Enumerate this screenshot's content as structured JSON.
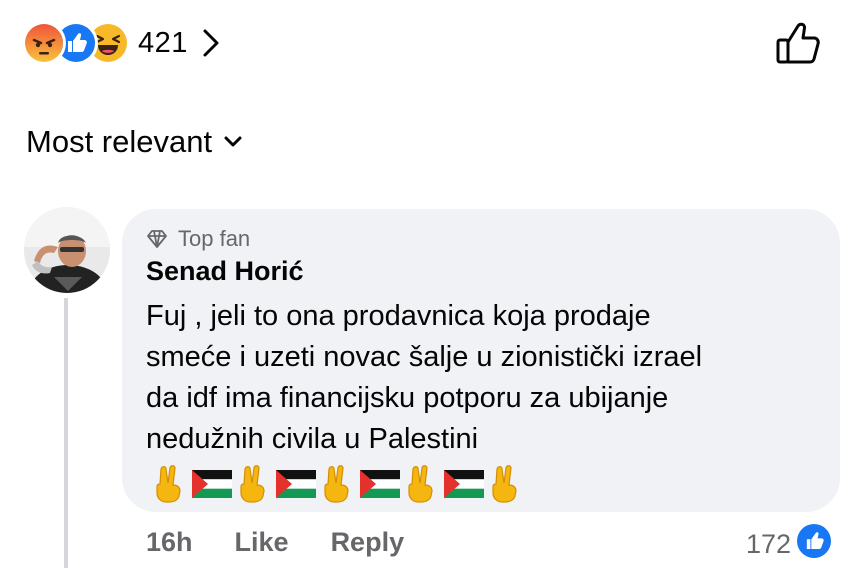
{
  "reactions": {
    "icons": [
      "angry-icon",
      "like-icon",
      "haha-icon"
    ],
    "count": "421"
  },
  "sort": {
    "label": "Most relevant"
  },
  "comment": {
    "badge": "Top fan",
    "author": "Senad Horić",
    "lines": [
      "Fuj , jeli to ona prodavnica koja prodaje",
      "smeće i uzeti novac šalje u zionistički izrael",
      "da idf ima financijsku potporu za ubijanje",
      "nedužnih civila u Palestini"
    ],
    "emojis": [
      "victory-hand",
      "palestine-flag",
      "victory-hand",
      "palestine-flag",
      "victory-hand",
      "palestine-flag",
      "victory-hand",
      "palestine-flag",
      "victory-hand"
    ],
    "time": "16h",
    "like_label": "Like",
    "reply_label": "Reply",
    "like_count": "172"
  },
  "colors": {
    "bubble": "#f0f2f5",
    "secondary_text": "#65676b",
    "facebook_blue": "#1877f2"
  }
}
